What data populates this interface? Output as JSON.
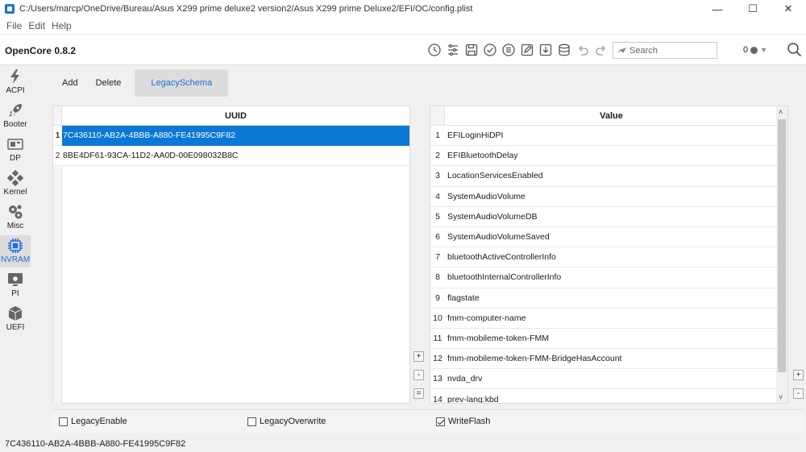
{
  "window": {
    "title": "C:/Users/marcp/OneDrive/Bureau/Asus X299 prime deluxe2 version2/Asus X299 prime Deluxe2/EFI/OC/config.plist",
    "minimize": "—",
    "maximize": "☐",
    "close": "✕"
  },
  "menu": {
    "file": "File",
    "edit": "Edit",
    "help": "Help"
  },
  "toolbar": {
    "version": "OpenCore 0.8.2",
    "search_placeholder": "Search",
    "zoom_value": "0"
  },
  "sidebar": {
    "items": [
      {
        "label": "ACPI",
        "icon": "lightning-icon"
      },
      {
        "label": "Booter",
        "icon": "rocket-icon"
      },
      {
        "label": "DP",
        "icon": "device-properties-icon"
      },
      {
        "label": "Kernel",
        "icon": "kernel-icon"
      },
      {
        "label": "Misc",
        "icon": "gears-icon"
      },
      {
        "label": "NVRAM",
        "icon": "chip-icon",
        "active": true
      },
      {
        "label": "PI",
        "icon": "apple-monitor-icon"
      },
      {
        "label": "UEFI",
        "icon": "cube-icon"
      }
    ]
  },
  "subtabs": {
    "add": "Add",
    "delete": "Delete",
    "legacy_schema": "LegacySchema"
  },
  "left_table": {
    "header": "UUID",
    "rows": [
      {
        "num": "1",
        "value": "7C436110-AB2A-4BBB-A880-FE41995C9F82",
        "selected": true
      },
      {
        "num": "2",
        "value": "8BE4DF61-93CA-11D2-AA0D-00E098032B8C"
      }
    ]
  },
  "right_table": {
    "header": "Value",
    "rows": [
      {
        "num": "1",
        "value": "EFILoginHiDPI"
      },
      {
        "num": "2",
        "value": "EFIBluetoothDelay"
      },
      {
        "num": "3",
        "value": "LocationServicesEnabled"
      },
      {
        "num": "4",
        "value": "SystemAudioVolume"
      },
      {
        "num": "5",
        "value": "SystemAudioVolumeDB"
      },
      {
        "num": "6",
        "value": "SystemAudioVolumeSaved"
      },
      {
        "num": "7",
        "value": "bluetoothActiveControllerInfo"
      },
      {
        "num": "8",
        "value": "bluetoothInternalControllerInfo"
      },
      {
        "num": "9",
        "value": "flagstate"
      },
      {
        "num": "10",
        "value": "fmm-computer-name"
      },
      {
        "num": "11",
        "value": "fmm-mobileme-token-FMM"
      },
      {
        "num": "12",
        "value": "fmm-mobileme-token-FMM-BridgeHasAccount"
      },
      {
        "num": "13",
        "value": "nvda_drv"
      },
      {
        "num": "14",
        "value": "prev-lang:kbd"
      }
    ]
  },
  "buttons": {
    "plus": "+",
    "minus": "-",
    "equals": "="
  },
  "checkboxes": {
    "legacy_enable": {
      "label": "LegacyEnable",
      "checked": false
    },
    "legacy_overwrite": {
      "label": "LegacyOverwrite",
      "checked": false
    },
    "write_flash": {
      "label": "WriteFlash",
      "checked": true
    }
  },
  "status": {
    "text": "7C436110-AB2A-4BBB-A880-FE41995C9F82"
  },
  "colors": {
    "accent": "#0a78d7",
    "active_label": "#1e6fd9"
  }
}
